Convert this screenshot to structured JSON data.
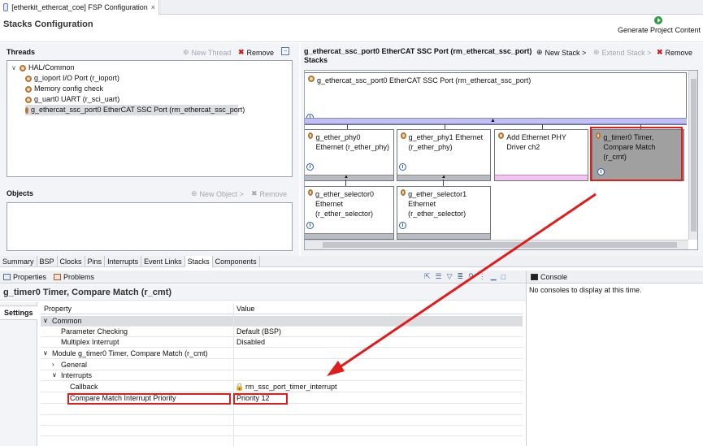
{
  "editor_tab": {
    "title": "[etherkit_ethercat_coe] FSP Configuration",
    "close": "×"
  },
  "header": {
    "title": "Stacks Configuration",
    "generate": "Generate Project Content"
  },
  "threads": {
    "title": "Threads",
    "new_thread": "New Thread",
    "remove": "Remove",
    "items": [
      {
        "label": "HAL/Common"
      },
      {
        "label": "g_ioport I/O Port (r_ioport)"
      },
      {
        "label": "Memory config check"
      },
      {
        "label": "g_uart0 UART (r_sci_uart)"
      },
      {
        "label": "g_ethercat_ssc_port0 EtherCAT SSC Port (rm_ethercat_ssc_port)"
      }
    ]
  },
  "objects": {
    "title": "Objects",
    "new_object": "New Object >",
    "remove": "Remove"
  },
  "stacks": {
    "title_line1": "g_ethercat_ssc_port0 EtherCAT SSC Port (rm_ethercat_ssc_port)",
    "title_line2": "Stacks",
    "new_stack": "New Stack >",
    "extend_stack": "Extend Stack >",
    "remove": "Remove",
    "top_block": "g_ethercat_ssc_port0 EtherCAT SSC Port (rm_ethercat_ssc_port)",
    "blocks": [
      {
        "label": "g_ether_phy0 Ethernet (r_ether_phy)"
      },
      {
        "label": "g_ether_phy1 Ethernet (r_ether_phy)"
      },
      {
        "label": "Add Ethernet PHY Driver ch2"
      },
      {
        "label": "g_timer0 Timer, Compare Match (r_cmt)"
      },
      {
        "label": "g_ether_selector0 Ethernet (r_ether_selector)"
      },
      {
        "label": "g_ether_selector1 Ethernet (r_ether_selector)"
      }
    ],
    "info": "i"
  },
  "bottom_tabs": [
    "Summary",
    "BSP",
    "Clocks",
    "Pins",
    "Interrupts",
    "Event Links",
    "Stacks",
    "Components"
  ],
  "views": {
    "properties": "Properties",
    "problems": "Problems",
    "console": "Console",
    "console_msg": "No consoles to display at this time."
  },
  "properties": {
    "title": "g_timer0 Timer, Compare Match (r_cmt)",
    "settings": "Settings",
    "col_property": "Property",
    "col_value": "Value",
    "rows": [
      {
        "property": "Common",
        "value": ""
      },
      {
        "property": "Parameter Checking",
        "value": "Default (BSP)"
      },
      {
        "property": "Multiplex Interrupt",
        "value": "Disabled"
      },
      {
        "property": "Module g_timer0 Timer, Compare Match (r_cmt)",
        "value": ""
      },
      {
        "property": "General",
        "value": ""
      },
      {
        "property": "Interrupts",
        "value": ""
      },
      {
        "property": "Callback",
        "value": "rm_ssc_port_timer_interrupt"
      },
      {
        "property": "Compare Match Interrupt Priority",
        "value": "Priority 12"
      }
    ]
  },
  "colors": {
    "highlight": "#e21b1b",
    "selected_block": "#a0a0a0",
    "bus": "#bfbff5"
  }
}
